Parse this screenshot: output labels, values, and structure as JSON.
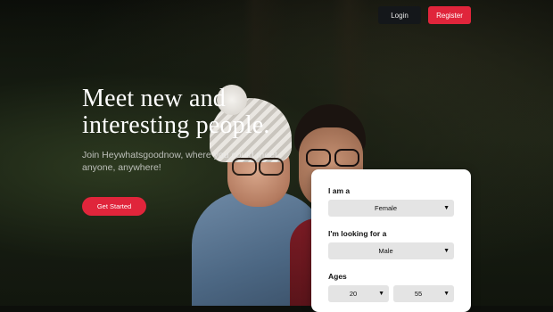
{
  "nav": {
    "login_label": "Login",
    "register_label": "Register"
  },
  "hero": {
    "headline_line1": "Meet new and",
    "headline_line2": "interesting people.",
    "subtitle": "Join Heywhatsgoodnow, where you could meet anyone, anywhere!",
    "cta_label": "Get Started"
  },
  "form": {
    "i_am_label": "I am a",
    "i_am_value": "Female",
    "looking_for_label": "I'm looking for a",
    "looking_for_value": "Male",
    "ages_label": "Ages",
    "age_min": "20",
    "age_max": "55"
  },
  "colors": {
    "accent": "#e0253b",
    "nav_dark": "#14171a",
    "select_bg": "#e4e4e4"
  },
  "icons": {
    "select_chevron": "chevron-down-icon"
  }
}
